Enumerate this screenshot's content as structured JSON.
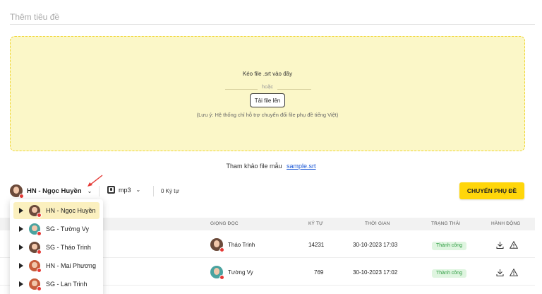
{
  "title_placeholder": "Thêm tiêu đề",
  "dropzone": {
    "instruction": "Kéo file .srt vào đây",
    "or": "hoặc",
    "upload_button": "Tải file lên",
    "note": "(Lưu ý: Hệ thống chỉ hỗ trợ chuyển đổi file phụ đề tiếng Việt)"
  },
  "sample": {
    "label": "Tham khảo file mẫu",
    "link": "sample.srt"
  },
  "toolbar": {
    "voice": "HN - Ngọc Huyền",
    "format": "mp3",
    "char_count": "0 Ký tự",
    "convert_button": "CHUYỂN PHỤ ĐỀ"
  },
  "table": {
    "headers": [
      "GIỌNG ĐỌC",
      "KÝ TỰ",
      "THỜI GIAN",
      "TRẠNG THÁI",
      "HÀNH ĐỘNG"
    ],
    "rows": [
      {
        "voice": "Tháo Trinh",
        "chars": "14231",
        "time": "30-10-2023 17:03",
        "status": "Thành công"
      },
      {
        "voice": "Tường Vy",
        "chars": "769",
        "time": "30-10-2023 17:02",
        "status": "Thành công"
      }
    ]
  },
  "dropdown": {
    "items": [
      "HN - Ngọc Huyền",
      "SG - Tường Vy",
      "SG - Tháo Trinh",
      "HN - Mai Phương",
      "SG - Lan Trinh"
    ]
  },
  "colors": {
    "accent": "#ffd60a",
    "dropzone_bg": "#fbf7c8",
    "success": "#2e9c42",
    "link": "#1a57d6"
  }
}
